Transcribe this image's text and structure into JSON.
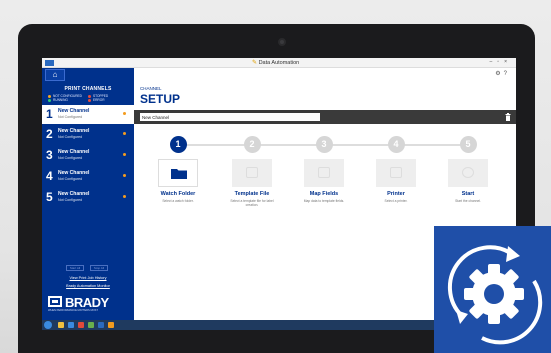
{
  "window": {
    "title": "Data Automation"
  },
  "sidebar": {
    "home_icon": "home-icon",
    "title": "PRINT CHANNELS",
    "legend": [
      {
        "label": "NOT CONFIGURED",
        "color": "#f5a623"
      },
      {
        "label": "STOPPED",
        "color": "#e74c3c"
      },
      {
        "label": "RUNNING",
        "color": "#2ecc71"
      },
      {
        "label": "ERROR",
        "color": "#e74c3c"
      }
    ],
    "channels": [
      {
        "num": "1",
        "name": "New Channel",
        "status": "Not Configured"
      },
      {
        "num": "2",
        "name": "New Channel",
        "status": "Not Configured"
      },
      {
        "num": "3",
        "name": "New Channel",
        "status": "Not Configured"
      },
      {
        "num": "4",
        "name": "New Channel",
        "status": "Not Configured"
      },
      {
        "num": "5",
        "name": "New Channel",
        "status": "Not Configured"
      }
    ],
    "start_all": "Start All",
    "stop_all": "Stop All",
    "history_link": "View Print Job History",
    "monitor_link": "Brady Automation Monitor",
    "brand": "BRADY",
    "tagline": "WHEN PERFORMANCE MATTERS MOST"
  },
  "main": {
    "channel_label": "CHANNEL",
    "setup_title": "SETUP",
    "channel_name_value": "New Channel",
    "steps": [
      {
        "num": "1",
        "title": "Watch Folder",
        "desc": "Select a watch folder."
      },
      {
        "num": "2",
        "title": "Template File",
        "desc": "Select a template file for label creation."
      },
      {
        "num": "3",
        "title": "Map Fields",
        "desc": "Map data to template fields."
      },
      {
        "num": "4",
        "title": "Printer",
        "desc": "Select a printer."
      },
      {
        "num": "5",
        "title": "Start",
        "desc": "Start the channel."
      }
    ]
  },
  "colors": {
    "brand_blue": "#00318c",
    "accent_orange": "#f39c1f"
  }
}
